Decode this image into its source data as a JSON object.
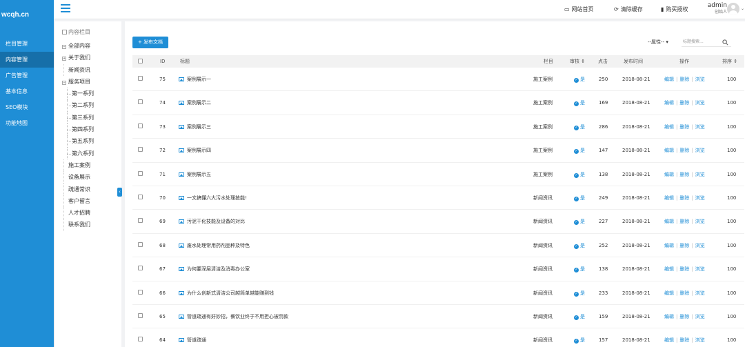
{
  "logo": "wcqh.cn",
  "sidebar": {
    "items": [
      {
        "label": "栏目管理",
        "active": false
      },
      {
        "label": "内容管理",
        "active": true
      },
      {
        "label": "广告管理",
        "active": false
      },
      {
        "label": "基本信息",
        "active": false
      },
      {
        "label": "SEO模块",
        "active": false
      },
      {
        "label": "功能地图",
        "active": false
      }
    ]
  },
  "topbar": {
    "links": [
      {
        "icon": "monitor-icon",
        "label": "网站首页"
      },
      {
        "icon": "refresh-icon",
        "label": "清除缓存"
      },
      {
        "icon": "bookmark-icon",
        "label": "购买授权"
      }
    ],
    "user_name": "admin",
    "user_role": "创始人"
  },
  "tree": {
    "header": "内容栏目",
    "items": [
      {
        "label": "全部内容",
        "level": 1,
        "toggle": "−"
      },
      {
        "label": "关于我们",
        "level": 1,
        "toggle": "+"
      },
      {
        "label": "新闻资讯",
        "level": 0
      },
      {
        "label": "服务项目",
        "level": 1,
        "toggle": "−"
      },
      {
        "label": "第一系列",
        "level": 2
      },
      {
        "label": "第二系列",
        "level": 2
      },
      {
        "label": "第三系列",
        "level": 2
      },
      {
        "label": "第四系列",
        "level": 2
      },
      {
        "label": "第五系列",
        "level": 2
      },
      {
        "label": "第六系列",
        "level": 2
      },
      {
        "label": "施工案例",
        "level": 0
      },
      {
        "label": "设备展示",
        "level": 0
      },
      {
        "label": "疏通常识",
        "level": 0
      },
      {
        "label": "客户留言",
        "level": 0
      },
      {
        "label": "人才招聘",
        "level": 0
      },
      {
        "label": "联系我们",
        "level": 0
      }
    ]
  },
  "toolbar": {
    "add_label": "+ 发布文档",
    "attr_select": "--属性--",
    "search_placeholder": "标题搜索..."
  },
  "table": {
    "headers": {
      "id": "ID",
      "title": "标题",
      "column": "栏目",
      "audit": "审核 ⇕",
      "clicks": "点击",
      "date": "发布时间",
      "ops": "操作",
      "sort": "排序 ⇕"
    },
    "actions": {
      "edit": "编辑",
      "delete": "删除",
      "view": "浏览"
    },
    "audit_label": "是",
    "rows": [
      {
        "id": "75",
        "title": "案例展示一",
        "column": "施工案例",
        "clicks": "250",
        "date": "2018-08-21",
        "sort": "100"
      },
      {
        "id": "74",
        "title": "案例展示二",
        "column": "施工案例",
        "clicks": "169",
        "date": "2018-08-21",
        "sort": "100"
      },
      {
        "id": "73",
        "title": "案例展示三",
        "column": "施工案例",
        "clicks": "286",
        "date": "2018-08-21",
        "sort": "100"
      },
      {
        "id": "72",
        "title": "案例展示四",
        "column": "施工案例",
        "clicks": "147",
        "date": "2018-08-21",
        "sort": "100"
      },
      {
        "id": "71",
        "title": "案例展示五",
        "column": "施工案例",
        "clicks": "138",
        "date": "2018-08-21",
        "sort": "100"
      },
      {
        "id": "70",
        "title": "一文搞懂六大污水处理技能!",
        "column": "新闻资讯",
        "clicks": "249",
        "date": "2018-08-21",
        "sort": "100"
      },
      {
        "id": "69",
        "title": "污泥干化技能及设备的对比",
        "column": "新闻资讯",
        "clicks": "227",
        "date": "2018-08-21",
        "sort": "100"
      },
      {
        "id": "68",
        "title": "废水处理常用药剂品种及特色",
        "column": "新闻资讯",
        "clicks": "252",
        "date": "2018-08-21",
        "sort": "100"
      },
      {
        "id": "67",
        "title": "为何要深层清洁及消毒办公室",
        "column": "新闻资讯",
        "clicks": "138",
        "date": "2018-08-21",
        "sort": "100"
      },
      {
        "id": "66",
        "title": "为什么创新式清洁公司越简单越能赚到钱",
        "column": "新闻资讯",
        "clicks": "233",
        "date": "2018-08-21",
        "sort": "100"
      },
      {
        "id": "65",
        "title": "管道疏通有好妙招，餐饮业终于不用担心被罚款",
        "column": "新闻资讯",
        "clicks": "159",
        "date": "2018-08-21",
        "sort": "100"
      },
      {
        "id": "64",
        "title": "管道疏通",
        "column": "新闻资讯",
        "clicks": "157",
        "date": "2018-08-21",
        "sort": "100"
      }
    ]
  },
  "colors": {
    "accent": "#1f8ed6",
    "sidebar_active": "#166fa9"
  }
}
